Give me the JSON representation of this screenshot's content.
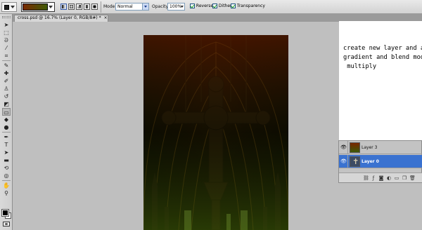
{
  "options_bar": {
    "tool_preset_icon": "gradient-tool-icon",
    "gradient_colors": [
      "#7a2a00",
      "#3f5a05"
    ],
    "mode_label": "Mode:",
    "mode_value": "Normal",
    "opacity_label": "Opacity:",
    "opacity_value": "100%",
    "reverse_label": "Reverse",
    "dither_label": "Dither",
    "transparency_label": "Transparency"
  },
  "document": {
    "tab_title": "cross.psd @ 16.7% (Layer 0, RGB/8#) *",
    "close_glyph": "×"
  },
  "toolbox": {
    "tools": [
      {
        "name": "move-tool-icon",
        "glyph": "➤"
      },
      {
        "name": "marquee-tool-icon",
        "glyph": "⬚"
      },
      {
        "name": "lasso-tool-icon",
        "glyph": "ᘐ"
      },
      {
        "name": "magic-wand-icon",
        "glyph": "⁄"
      },
      {
        "name": "crop-tool-icon",
        "glyph": "⌗"
      },
      {
        "name": "eyedropper-icon",
        "glyph": "✎"
      },
      {
        "name": "healing-brush-icon",
        "glyph": "✚"
      },
      {
        "name": "brush-tool-icon",
        "glyph": "✐"
      },
      {
        "name": "clone-stamp-icon",
        "glyph": "♙"
      },
      {
        "name": "history-brush-icon",
        "glyph": "↺"
      },
      {
        "name": "eraser-icon",
        "glyph": "◩"
      },
      {
        "name": "gradient-tool-icon",
        "glyph": "▭"
      },
      {
        "name": "blur-tool-icon",
        "glyph": "◆"
      },
      {
        "name": "dodge-tool-icon",
        "glyph": "●"
      },
      {
        "name": "pen-tool-icon",
        "glyph": "✒"
      },
      {
        "name": "type-tool-icon",
        "glyph": "T"
      },
      {
        "name": "path-selection-icon",
        "glyph": "➤"
      },
      {
        "name": "shape-tool-icon",
        "glyph": "▬"
      },
      {
        "name": "3d-rotate-icon",
        "glyph": "⟲"
      },
      {
        "name": "3d-orbit-icon",
        "glyph": "◎"
      },
      {
        "name": "hand-tool-icon",
        "glyph": "✋"
      },
      {
        "name": "zoom-tool-icon",
        "glyph": "⚲"
      }
    ],
    "foreground_color": "#000000",
    "background_color": "#ffffff"
  },
  "note": {
    "text": "create new layer and apply\ngradient and blend mode to\n multiply"
  },
  "layers_panel": {
    "layers": [
      {
        "name": "Layer 3",
        "visible_glyph": "👁",
        "thumb": "gradient",
        "selected": false
      },
      {
        "name": "Layer 0",
        "visible_glyph": "👁",
        "thumb": "cross-image",
        "selected": true
      }
    ],
    "footer_buttons": [
      {
        "name": "link-layers-icon",
        "glyph": "⛓"
      },
      {
        "name": "layer-style-icon",
        "glyph": "ƒ"
      },
      {
        "name": "add-mask-icon",
        "glyph": "◙"
      },
      {
        "name": "adjustment-layer-icon",
        "glyph": "◐"
      },
      {
        "name": "new-group-icon",
        "glyph": "▭"
      },
      {
        "name": "new-layer-icon",
        "glyph": "❐"
      },
      {
        "name": "delete-layer-icon",
        "glyph": "🗑"
      }
    ]
  }
}
